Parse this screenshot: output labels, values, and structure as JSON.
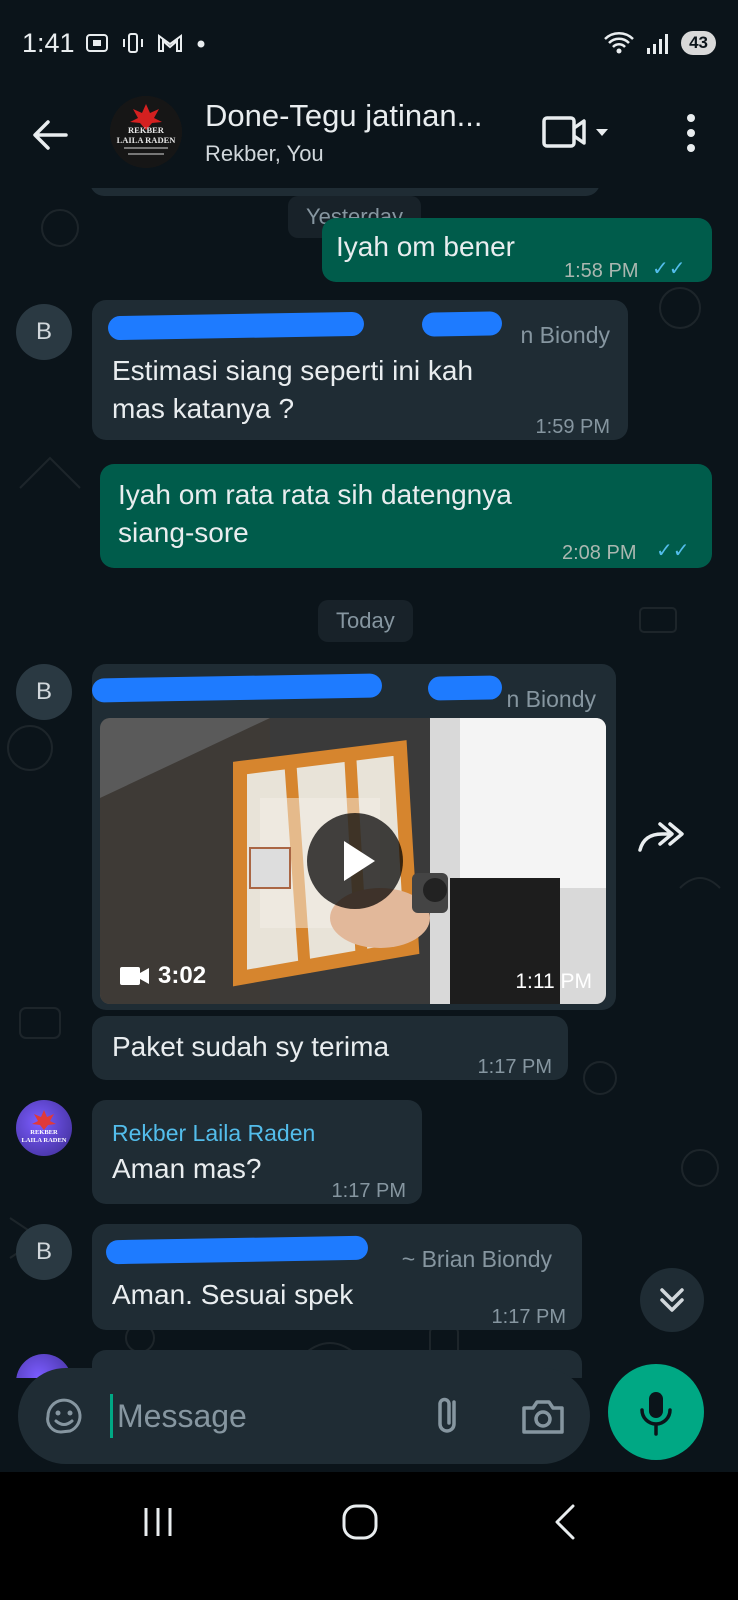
{
  "status_bar": {
    "time": "1:41",
    "battery": "43"
  },
  "header": {
    "title": "Done-Tegu jatinan...",
    "subtitle": "Rekber, You",
    "avatar_logo_text": "REKBER LAILA RADEN"
  },
  "messages": {
    "date_yesterday": "Yesterday",
    "date_today": "Today",
    "m1": {
      "text": "Iyah om bener",
      "time": "1:58 PM"
    },
    "m2": {
      "sender": "n Biondy",
      "text_line1": "Estimasi siang seperti ini kah",
      "text_line2": "mas katanya ?",
      "time": "1:59 PM"
    },
    "m3": {
      "text_line1": "Iyah om rata rata sih datengnya",
      "text_line2": "siang-sore",
      "time": "2:08 PM"
    },
    "m4": {
      "sender": "n Biondy",
      "video_duration": "3:02",
      "time": "1:11 PM"
    },
    "m5": {
      "text": "Paket sudah sy terima",
      "time": "1:17 PM"
    },
    "m6": {
      "sender": "Rekber Laila Raden",
      "text": "Aman mas?",
      "time": "1:17 PM"
    },
    "m7": {
      "sender": "~ Brian Biondy",
      "text": "Aman. Sesuai spek",
      "time": "1:17 PM"
    },
    "avatar_letter": "B"
  },
  "composer": {
    "placeholder": "Message"
  },
  "colors": {
    "background": "#0b141a",
    "outgoing_bubble": "#005c4b",
    "incoming_bubble": "#1f2c34",
    "accent": "#00a884",
    "read_ticks": "#53bdeb"
  }
}
